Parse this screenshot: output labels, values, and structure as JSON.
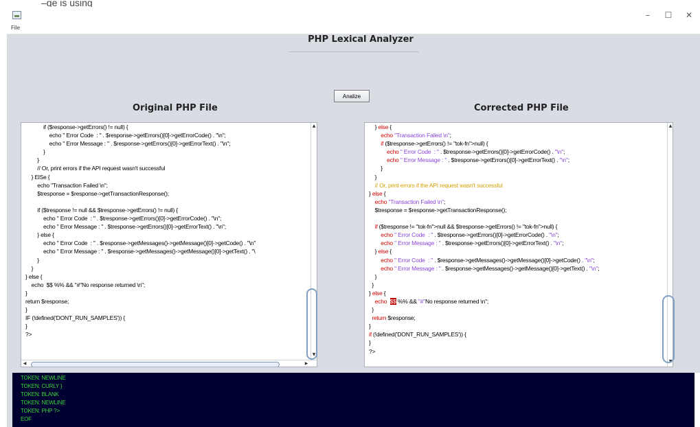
{
  "window": {
    "minimize_glyph": "–",
    "maximize_glyph": "☐",
    "close_glyph": "✕"
  },
  "menu": {
    "file_label": "File"
  },
  "app": {
    "title": "PHP Lexical Analyzer",
    "analize_label": "Analize"
  },
  "left_panel": {
    "title": "Original PHP File",
    "lines": [
      "            if ($response->getErrors() != null) {",
      "                echo \" Error Code  : \" . $response->getErrors()[0]->getErrorCode() . \"\\n\";",
      "                echo \" Error Message : \" . $response->getErrors()[0]->getErrorText() . \"\\n\";",
      "            }",
      "        }",
      "        // Or, print errors if the API request wasn't successful",
      "    } ElSe {",
      "        echo \"Transaction Failed \\n\";",
      "        $tresponse = $response->getTransactionResponse();",
      "",
      "        if ($tresponse != null && $tresponse->getErrors() != null) {",
      "            echo \" Error Code  : \" . $tresponse->getErrors()[0]->getErrorCode() . \"\\n\";",
      "            echo \" Error Message : \" . $tresponse->getErrors()[0]->getErrorText() . \"\\n\";",
      "        } else {",
      "            echo \" Error Code  : \" . $response->getMessages()->getMessage()[0]->getCode() . \"\\n\"",
      "            echo \" Error Message : \" . $response->getMessages()->getMessage()[0]->getText() . \"\\",
      "        }",
      "    }",
      "} else {",
      "    echo  $$ %% && \"#\"No response returned \\n\";",
      "}",
      "return $response;",
      "}",
      "IF (!defined('DONT_RUN_SAMPLES')) {",
      "}",
      "?>"
    ]
  },
  "right_panel": {
    "title": "Corrected PHP File",
    "lines": [
      "    } else {",
      "        echo \"Transaction Failed \\n\";",
      "        if ($tresponse->getErrors() != null) {",
      "            echo \" Error Code  : \" . $tresponse->getErrors()[0]->getErrorCode() . \"\\n\";",
      "            echo \" Error Message : \" . $tresponse->getErrors()[0]->getErrorText() . \"\\n\";",
      "        }",
      "    }",
      "    // Or, print errors if the API request wasn't successful",
      "} else {",
      "    echo \"Transaction Failed \\n\";",
      "    $tresponse = $response->getTransactionResponse();",
      "",
      "    if ($tresponse != null && $tresponse->getErrors() != null) {",
      "        echo \" Error Code  : \" . $tresponse->getErrors()[0]->getErrorCode() . \"\\n\";",
      "        echo \" Error Message : \" . $tresponse->getErrors()[0]->getErrorText() . \"\\n\";",
      "    } else {",
      "        echo \" Error Code  : \" . $response->getMessages()->getMessage()[0]->getCode() . \"\\n\";",
      "        echo \" Error Message : \" . $response->getMessages()->getMessage()[0]->getText() . \"\\n\";",
      "    }",
      "  }",
      "} else {",
      "    echo  $$ %% && \"#\"No response returned \\n\";",
      "  }",
      "  return $response;",
      "}",
      "if (!defined('DONT_RUN_SAMPLES')) {",
      "}",
      "?>"
    ]
  },
  "console": {
    "lines": [
      "TOKEN: NEWLINE",
      "TOKEN: CURLY }",
      "TOKEN: BLANK",
      "TOKEN: NEWLINE",
      "TOKEN: PHP ?>",
      "EOF"
    ]
  },
  "colors": {
    "background": "#d9dde3",
    "console_bg": "#000030",
    "console_fg": "#39d639",
    "keyword": "#d00000",
    "function": "#8a47d8",
    "comment": "#d4a000",
    "error_bg": "#c00000",
    "highlight_bg": "#ffe500"
  }
}
